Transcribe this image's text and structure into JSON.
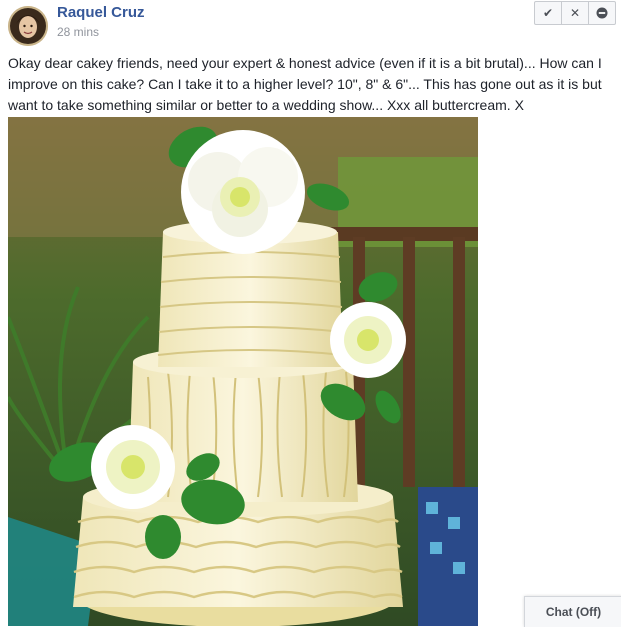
{
  "post": {
    "author": "Raquel Cruz",
    "timestamp": "28 mins",
    "text": "Okay dear cakey friends, need your expert & honest advice (even if it is a bit brutal)... How can I improve on this cake? Can I take it to a higher level? 10\", 8\" & 6\"... This has gone out as it is but want to take something similar or better to a wedding show... Xxx all buttercream. X",
    "actions": [
      {
        "icon": "check-icon",
        "glyph": "✔"
      },
      {
        "icon": "close-icon",
        "glyph": "✕"
      },
      {
        "icon": "minus-circle-icon",
        "glyph": "−"
      }
    ]
  },
  "chat": {
    "label": "Chat (Off)"
  },
  "colors": {
    "link": "#365899",
    "text": "#1d2129",
    "muted": "#90949c"
  }
}
